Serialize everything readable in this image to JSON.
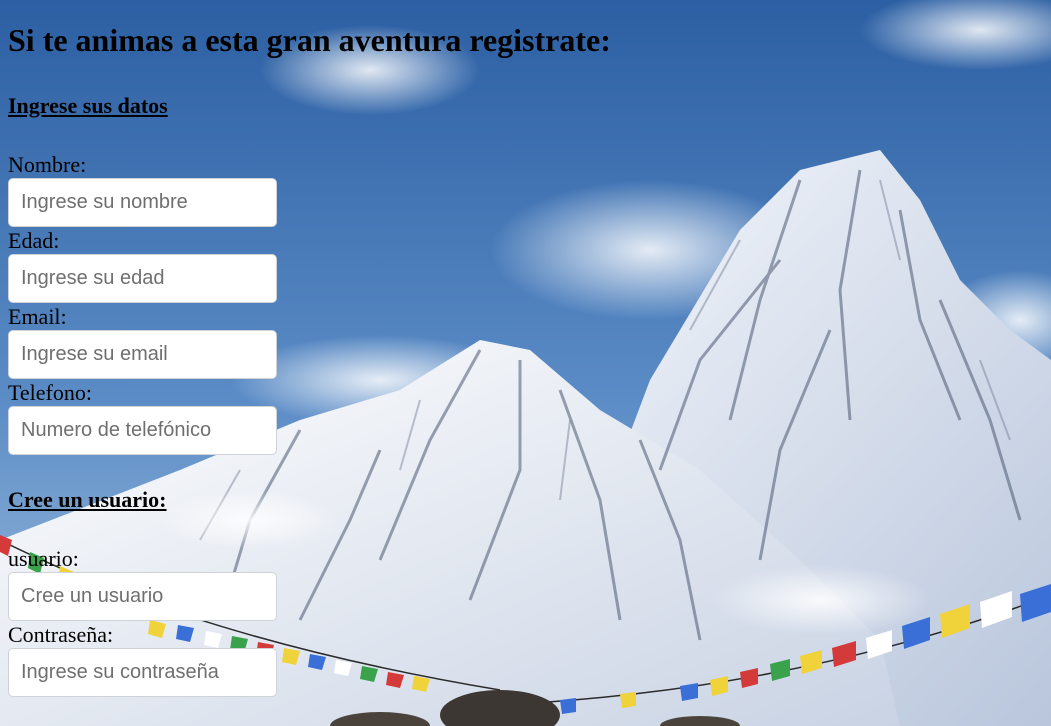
{
  "page": {
    "title": "Si te animas a esta gran aventura registrate:"
  },
  "personal_section": {
    "heading": "Ingrese sus datos",
    "fields": [
      {
        "label": "Nombre:",
        "placeholder": "Ingrese su nombre",
        "value": ""
      },
      {
        "label": "Edad:",
        "placeholder": "Ingrese su edad",
        "value": ""
      },
      {
        "label": "Email:",
        "placeholder": "Ingrese su email",
        "value": ""
      },
      {
        "label": "Telefono:",
        "placeholder": "Numero de telefónico",
        "value": ""
      }
    ]
  },
  "user_section": {
    "heading": "Cree un usuario:",
    "fields": [
      {
        "label": "usuario:",
        "placeholder": "Cree un usuario",
        "value": ""
      },
      {
        "label": "Contraseña:",
        "placeholder": "Ingrese su contraseña",
        "value": ""
      }
    ]
  },
  "colors": {
    "sky_top": "#2f63a8",
    "sky_bottom": "#8db2d8",
    "snow": "#eef2f8",
    "rock": "#5a6478"
  }
}
